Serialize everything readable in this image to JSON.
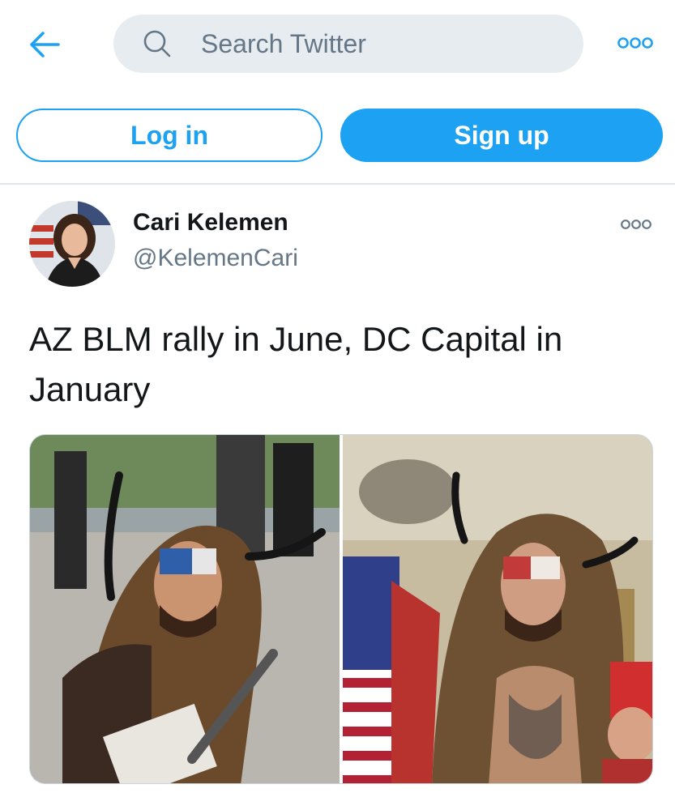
{
  "header": {
    "back_icon": "arrow-left-icon",
    "search": {
      "placeholder": "Search Twitter",
      "value": "",
      "icon": "search-icon"
    },
    "more_icon": "more-horizontal-icon"
  },
  "auth": {
    "login_label": "Log in",
    "signup_label": "Sign up"
  },
  "tweet": {
    "author_name": "Cari Kelemen",
    "author_handle": "@KelemenCari",
    "text": "AZ BLM rally in June, DC Capital in January",
    "more_icon": "more-horizontal-icon",
    "media": [
      {
        "description": "photo-left"
      },
      {
        "description": "photo-right"
      }
    ]
  },
  "colors": {
    "accent": "#1da1f2",
    "search_bg": "#e6ecf0",
    "secondary_text": "#657786",
    "divider": "#e1e8ed"
  }
}
